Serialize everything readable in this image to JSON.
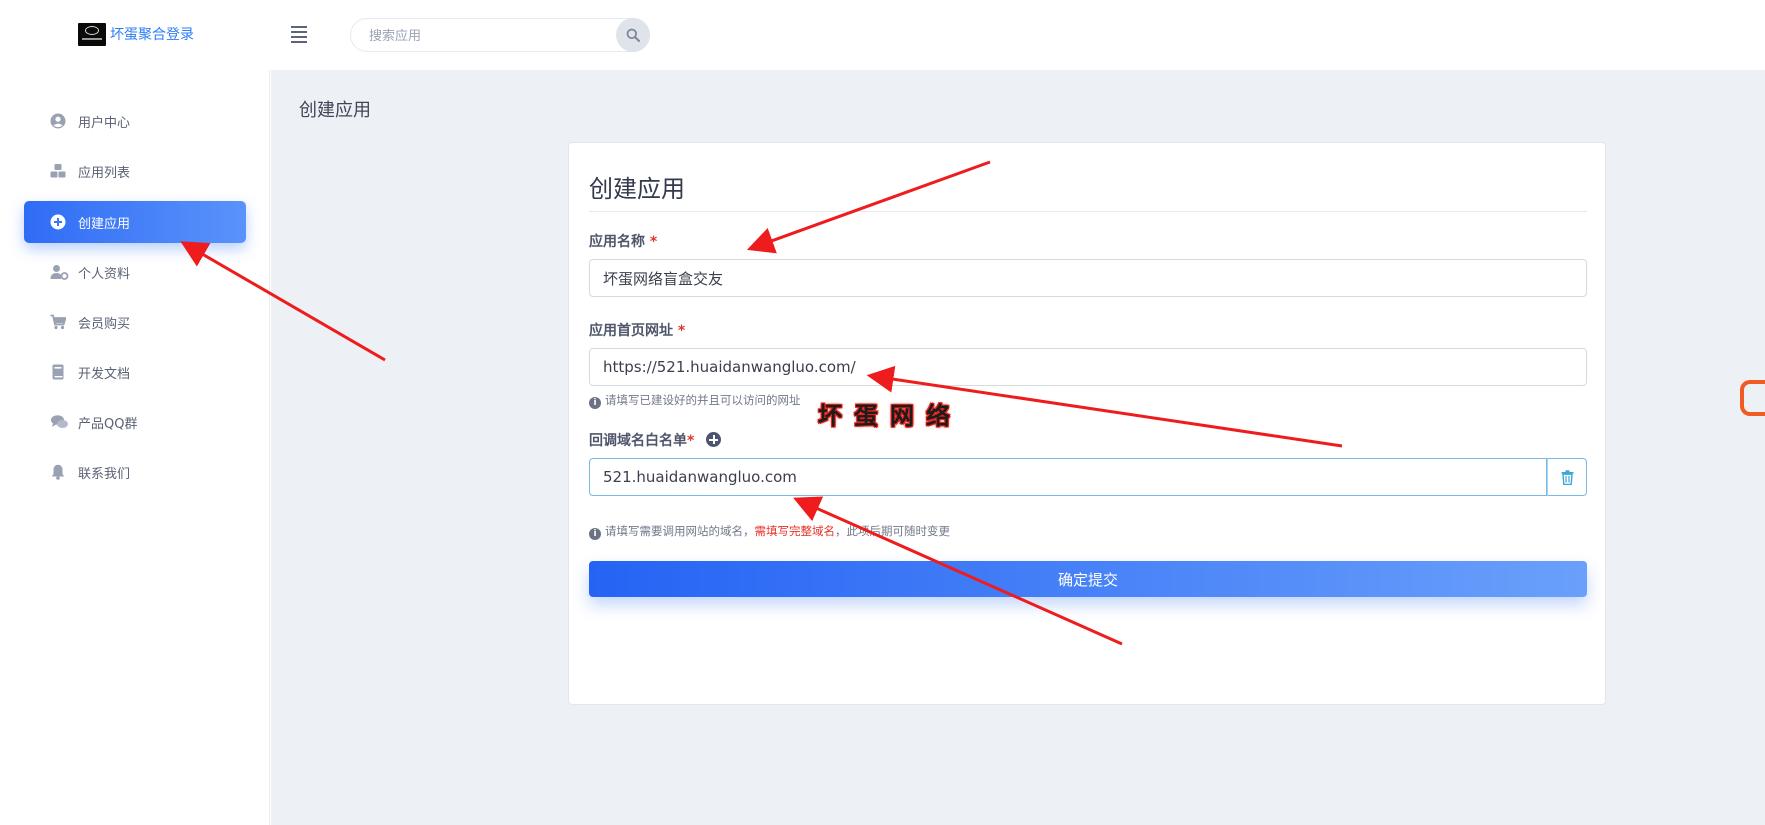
{
  "header": {
    "brand": "坏蛋聚合登录",
    "search_placeholder": "搜索应用"
  },
  "sidebar": {
    "items": [
      {
        "label": "用户中心",
        "icon": "user-circle-icon"
      },
      {
        "label": "应用列表",
        "icon": "cubes-icon"
      },
      {
        "label": "创建应用",
        "icon": "plus-circle-icon",
        "active": true
      },
      {
        "label": "个人资料",
        "icon": "user-gear-icon"
      },
      {
        "label": "会员购买",
        "icon": "cart-icon"
      },
      {
        "label": "开发文档",
        "icon": "book-icon"
      },
      {
        "label": "产品QQ群",
        "icon": "comments-icon"
      },
      {
        "label": "联系我们",
        "icon": "bell-icon"
      }
    ]
  },
  "main": {
    "page_title": "创建应用",
    "form": {
      "title": "创建应用",
      "app_name_label": "应用名称",
      "app_name_value": "坏蛋网络盲盒交友",
      "homepage_label": "应用首页网址",
      "homepage_value": "https://521.huaidanwangluo.com/",
      "homepage_help": "请填写已建设好的并且可以访问的网址",
      "callback_label": "回调域名白名单",
      "callback_value": "521.huaidanwangluo.com",
      "callback_help_prefix": "请填写需要调用网站的域名，",
      "callback_help_warn": "需填写完整域名",
      "callback_help_suffix": "，此项后期可随时变更",
      "required_mark": "*",
      "submit_label": "确定提交"
    }
  },
  "watermark": "坏蛋网络",
  "colors": {
    "accent": "#2f6cf5",
    "required": "#e0352b",
    "annotation_arrow": "#ee1c1c",
    "background": "#edf0f5"
  }
}
